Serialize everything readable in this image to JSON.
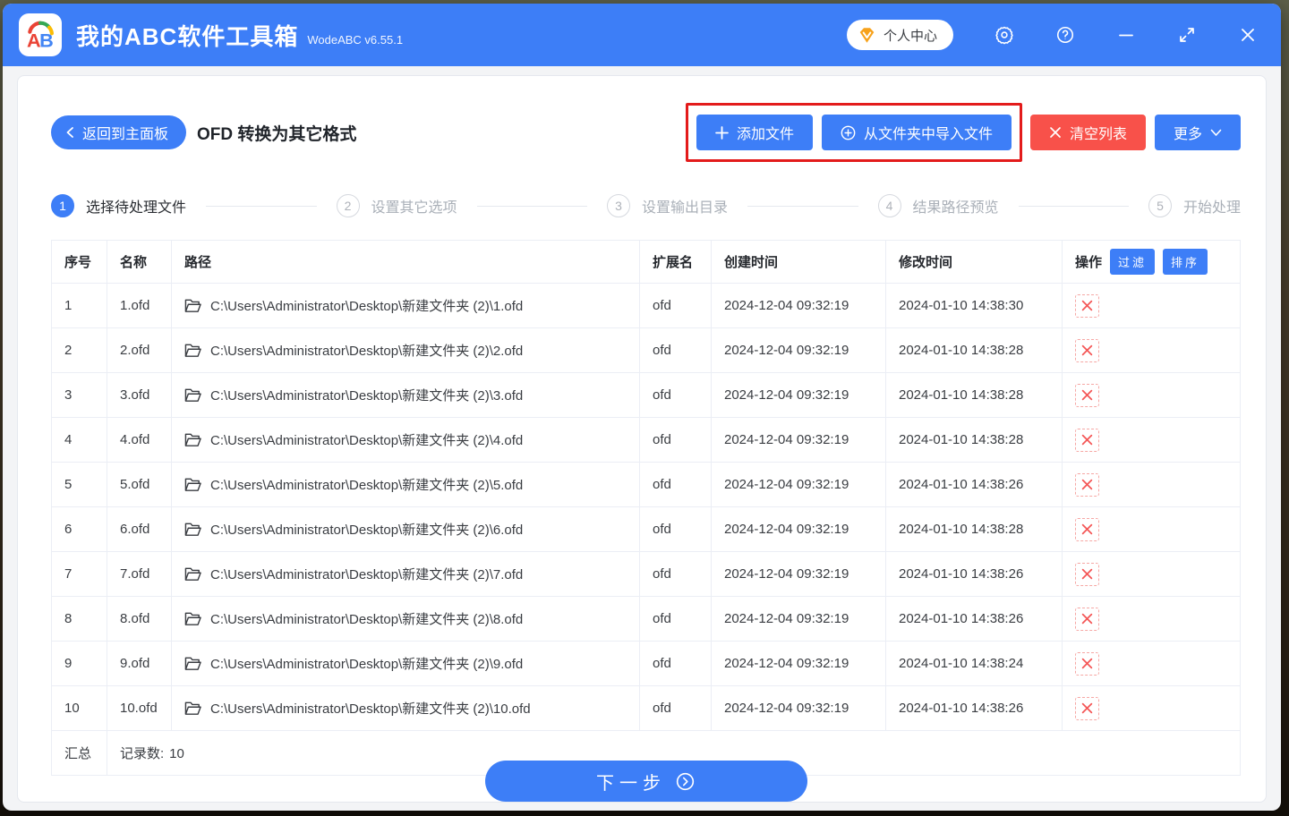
{
  "window": {
    "app_title": "我的ABC软件工具箱",
    "app_version": "WodeABC v6.55.1",
    "personal_center_label": "个人中心"
  },
  "toolbar": {
    "back_label": "返回到主面板",
    "page_title": "OFD 转换为其它格式",
    "add_files_label": "添加文件",
    "import_folder_label": "从文件夹中导入文件",
    "clear_list_label": "清空列表",
    "more_label": "更多"
  },
  "steps": [
    {
      "num": "1",
      "label": "选择待处理文件",
      "active": true
    },
    {
      "num": "2",
      "label": "设置其它选项",
      "active": false
    },
    {
      "num": "3",
      "label": "设置输出目录",
      "active": false
    },
    {
      "num": "4",
      "label": "结果路径预览",
      "active": false
    },
    {
      "num": "5",
      "label": "开始处理",
      "active": false
    }
  ],
  "table": {
    "headers": [
      "序号",
      "名称",
      "路径",
      "扩展名",
      "创建时间",
      "修改时间",
      "操作"
    ],
    "filter_label": "过滤",
    "sort_label": "排序",
    "rows": [
      {
        "index": "1",
        "name": "1.ofd",
        "path": "C:\\Users\\Administrator\\Desktop\\新建文件夹 (2)\\1.ofd",
        "ext": "ofd",
        "created": "2024-12-04 09:32:19",
        "modified": "2024-01-10 14:38:30"
      },
      {
        "index": "2",
        "name": "2.ofd",
        "path": "C:\\Users\\Administrator\\Desktop\\新建文件夹 (2)\\2.ofd",
        "ext": "ofd",
        "created": "2024-12-04 09:32:19",
        "modified": "2024-01-10 14:38:28"
      },
      {
        "index": "3",
        "name": "3.ofd",
        "path": "C:\\Users\\Administrator\\Desktop\\新建文件夹 (2)\\3.ofd",
        "ext": "ofd",
        "created": "2024-12-04 09:32:19",
        "modified": "2024-01-10 14:38:28"
      },
      {
        "index": "4",
        "name": "4.ofd",
        "path": "C:\\Users\\Administrator\\Desktop\\新建文件夹 (2)\\4.ofd",
        "ext": "ofd",
        "created": "2024-12-04 09:32:19",
        "modified": "2024-01-10 14:38:28"
      },
      {
        "index": "5",
        "name": "5.ofd",
        "path": "C:\\Users\\Administrator\\Desktop\\新建文件夹 (2)\\5.ofd",
        "ext": "ofd",
        "created": "2024-12-04 09:32:19",
        "modified": "2024-01-10 14:38:26"
      },
      {
        "index": "6",
        "name": "6.ofd",
        "path": "C:\\Users\\Administrator\\Desktop\\新建文件夹 (2)\\6.ofd",
        "ext": "ofd",
        "created": "2024-12-04 09:32:19",
        "modified": "2024-01-10 14:38:28"
      },
      {
        "index": "7",
        "name": "7.ofd",
        "path": "C:\\Users\\Administrator\\Desktop\\新建文件夹 (2)\\7.ofd",
        "ext": "ofd",
        "created": "2024-12-04 09:32:19",
        "modified": "2024-01-10 14:38:26"
      },
      {
        "index": "8",
        "name": "8.ofd",
        "path": "C:\\Users\\Administrator\\Desktop\\新建文件夹 (2)\\8.ofd",
        "ext": "ofd",
        "created": "2024-12-04 09:32:19",
        "modified": "2024-01-10 14:38:26"
      },
      {
        "index": "9",
        "name": "9.ofd",
        "path": "C:\\Users\\Administrator\\Desktop\\新建文件夹 (2)\\9.ofd",
        "ext": "ofd",
        "created": "2024-12-04 09:32:19",
        "modified": "2024-01-10 14:38:24"
      },
      {
        "index": "10",
        "name": "10.ofd",
        "path": "C:\\Users\\Administrator\\Desktop\\新建文件夹 (2)\\10.ofd",
        "ext": "ofd",
        "created": "2024-12-04 09:32:19",
        "modified": "2024-01-10 14:38:26"
      }
    ],
    "summary_label": "汇总",
    "record_count_label": "记录数:",
    "record_count": "10"
  },
  "footer": {
    "next_label": "下一步"
  },
  "colors": {
    "accent_blue": "#3d7ef7",
    "danger_red": "#f8514a",
    "annotation_red": "#e31b1b",
    "delete_icon_red": "#f45656"
  }
}
